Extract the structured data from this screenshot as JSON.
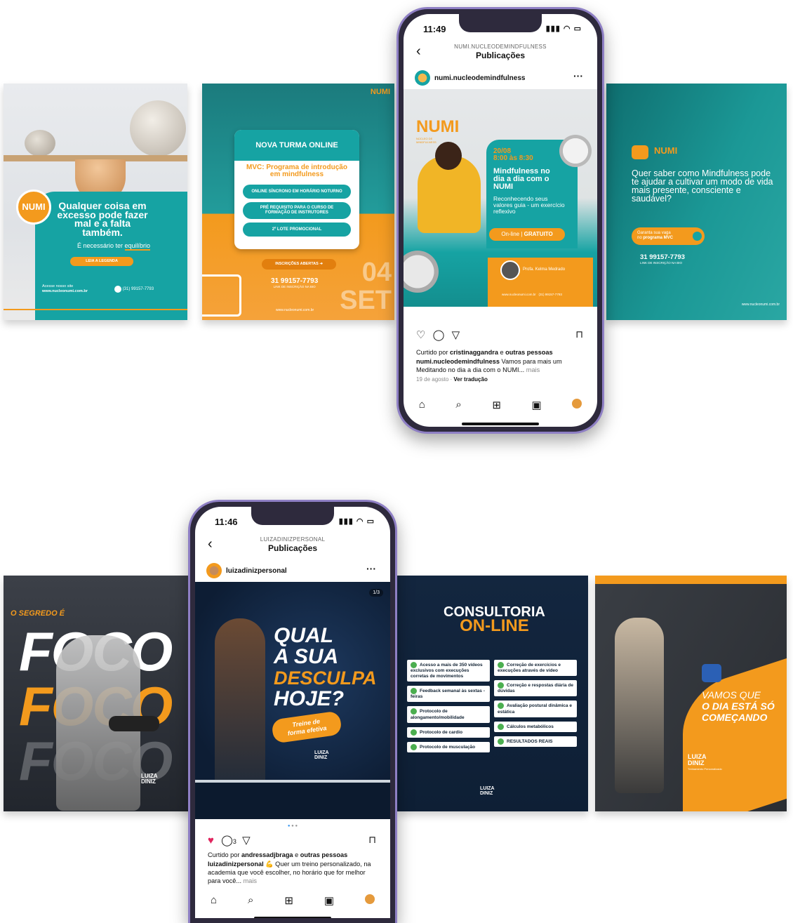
{
  "numi": {
    "post1": {
      "logo": "NUMI",
      "headline": "Qualquer coisa em excesso pode fazer mal e a falta também.",
      "sub_prefix": "É necessário ter ",
      "sub_highlight": "equilíbrio",
      "button": "LEIA A LEGENDA",
      "site_label": "Acesse nosso site",
      "site": "www.nucleonumi.com.br",
      "phone": "(31) 99157-7793"
    },
    "post2": {
      "logo": "NUMI",
      "title": "NOVA TURMA ONLINE",
      "program": "MVC: Programa de introdução em mindfulness",
      "items": [
        "ONLINE SÍNCRONO EM HORÁRIO NOTURNO",
        "PRÉ REQUISITO PARA O CURSO DE FORMAÇÃO DE INSTRUTORES",
        "2º LOTE PROMOCIONAL"
      ],
      "button": "INSCRIÇÕES ABERTAS",
      "phone": "31 99157-7793",
      "phone_sub": "LINK DE INSCRIÇÃO NA BIO",
      "date_day": "04",
      "date_month": "SET",
      "site": "www.nucleonumi.com.br"
    },
    "post4": {
      "logo": "NUMI",
      "headline": "Quer saber como Mindfulness pode te ajudar a cultivar um modo de vida mais presente, consciente e saudável?",
      "button_line1": "Garanta sua vaga",
      "button_line2_prefix": "no ",
      "button_line2_bold": "programa MVC",
      "phone": "31 99157-7793",
      "phone_sub": "LINK DE INSCRIÇÃO NA BIO",
      "site": "www.nucleonumi.com.br"
    },
    "phone": {
      "time": "11:49",
      "header_small": "NUMI.NUCLEODEMINDFULNESS",
      "header_big": "Publicações",
      "account": "numi.nucleodemindfulness",
      "post": {
        "logo": "NUMI",
        "logo_sub": "NÚCLEO DE MINDFULNESS",
        "date": "20/08",
        "time": "8:00 às 8:30",
        "title": "Mindfulness no dia a dia com o NUMI",
        "sub": "Reconhecendo seus valores guia - um exercício reflexivo",
        "button_prefix": "On-line | ",
        "button_bold": "GRATUITO",
        "prof": "Profa. Kelma Medrado",
        "site": "www.nucleonumi.com.br",
        "phone": "(31) 99157-7793"
      },
      "liked_prefix": "Curtido por ",
      "liked_user": "cristinaggandra",
      "liked_mid": " e ",
      "liked_others": "outras pessoas",
      "caption_user": "numi.nucleodemindfulness",
      "caption_text": " Vamos para mais um Meditando no dia a dia com o NUMI...",
      "caption_more": " mais",
      "date": "19 de agosto",
      "sep": " · ",
      "translate": "Ver tradução"
    }
  },
  "luiza": {
    "post1": {
      "kicker": "O SEGREDO É",
      "word": "FOCO",
      "brand_top": "LUIZA",
      "brand_bottom": "DINIZ"
    },
    "post3": {
      "title_top": "CONSULTORIA",
      "title_bottom": "ON-LINE",
      "left_items": [
        "Acesso a mais de 350 vídeos exclusivos com execuções corretas de movimentos",
        "Feedback semanal às sextas - feiras",
        "Protocolo de alongamento/mobilidade",
        "Protocolo de cardio",
        "Protocolo de musculação"
      ],
      "right_items": [
        "Correção de exercícios e execuções através de vídeo",
        "Correção e respostas diária de dúvidas",
        "Avaliação postural dinâmica e estática",
        "Cálculos metabólicos",
        "RESULTADOS REAIS"
      ],
      "brand_top": "LUIZA",
      "brand_bottom": "DINIZ"
    },
    "post4": {
      "line1": "VAMOS QUE",
      "line2": "O DIA ESTÁ SÓ",
      "line3": "COMEÇANDO",
      "brand_top": "LUIZA",
      "brand_bottom": "DINIZ",
      "brand_sub": "Treinamento Personalizado"
    },
    "phone": {
      "time": "11:46",
      "header_small": "LUIZADINIZPERSONAL",
      "header_big": "Publicações",
      "account": "luizadinizpersonal",
      "post": {
        "counter": "1/3",
        "line1": "QUAL",
        "line2": "A SUA",
        "line3": "DESCULPA",
        "line4": "HOJE?",
        "cta_line1": "Treine de",
        "cta_line2": "forma efetiva",
        "brand_top": "LUIZA",
        "brand_bottom": "DINIZ"
      },
      "comments": "3",
      "liked_prefix": "Curtido por ",
      "liked_user": "andressadjbraga",
      "liked_mid": " e ",
      "liked_others": "outras pessoas",
      "caption_user": "luizadinizpersonal",
      "caption_text": " 💪 Quer um treino personalizado, na academia que você escolher, no horário que for melhor para você...",
      "caption_more": " mais"
    }
  },
  "colors": {
    "teal": "#16a3a3",
    "orange": "#f39a1d",
    "navy": "#10243f",
    "dark": "#1b1f27"
  }
}
